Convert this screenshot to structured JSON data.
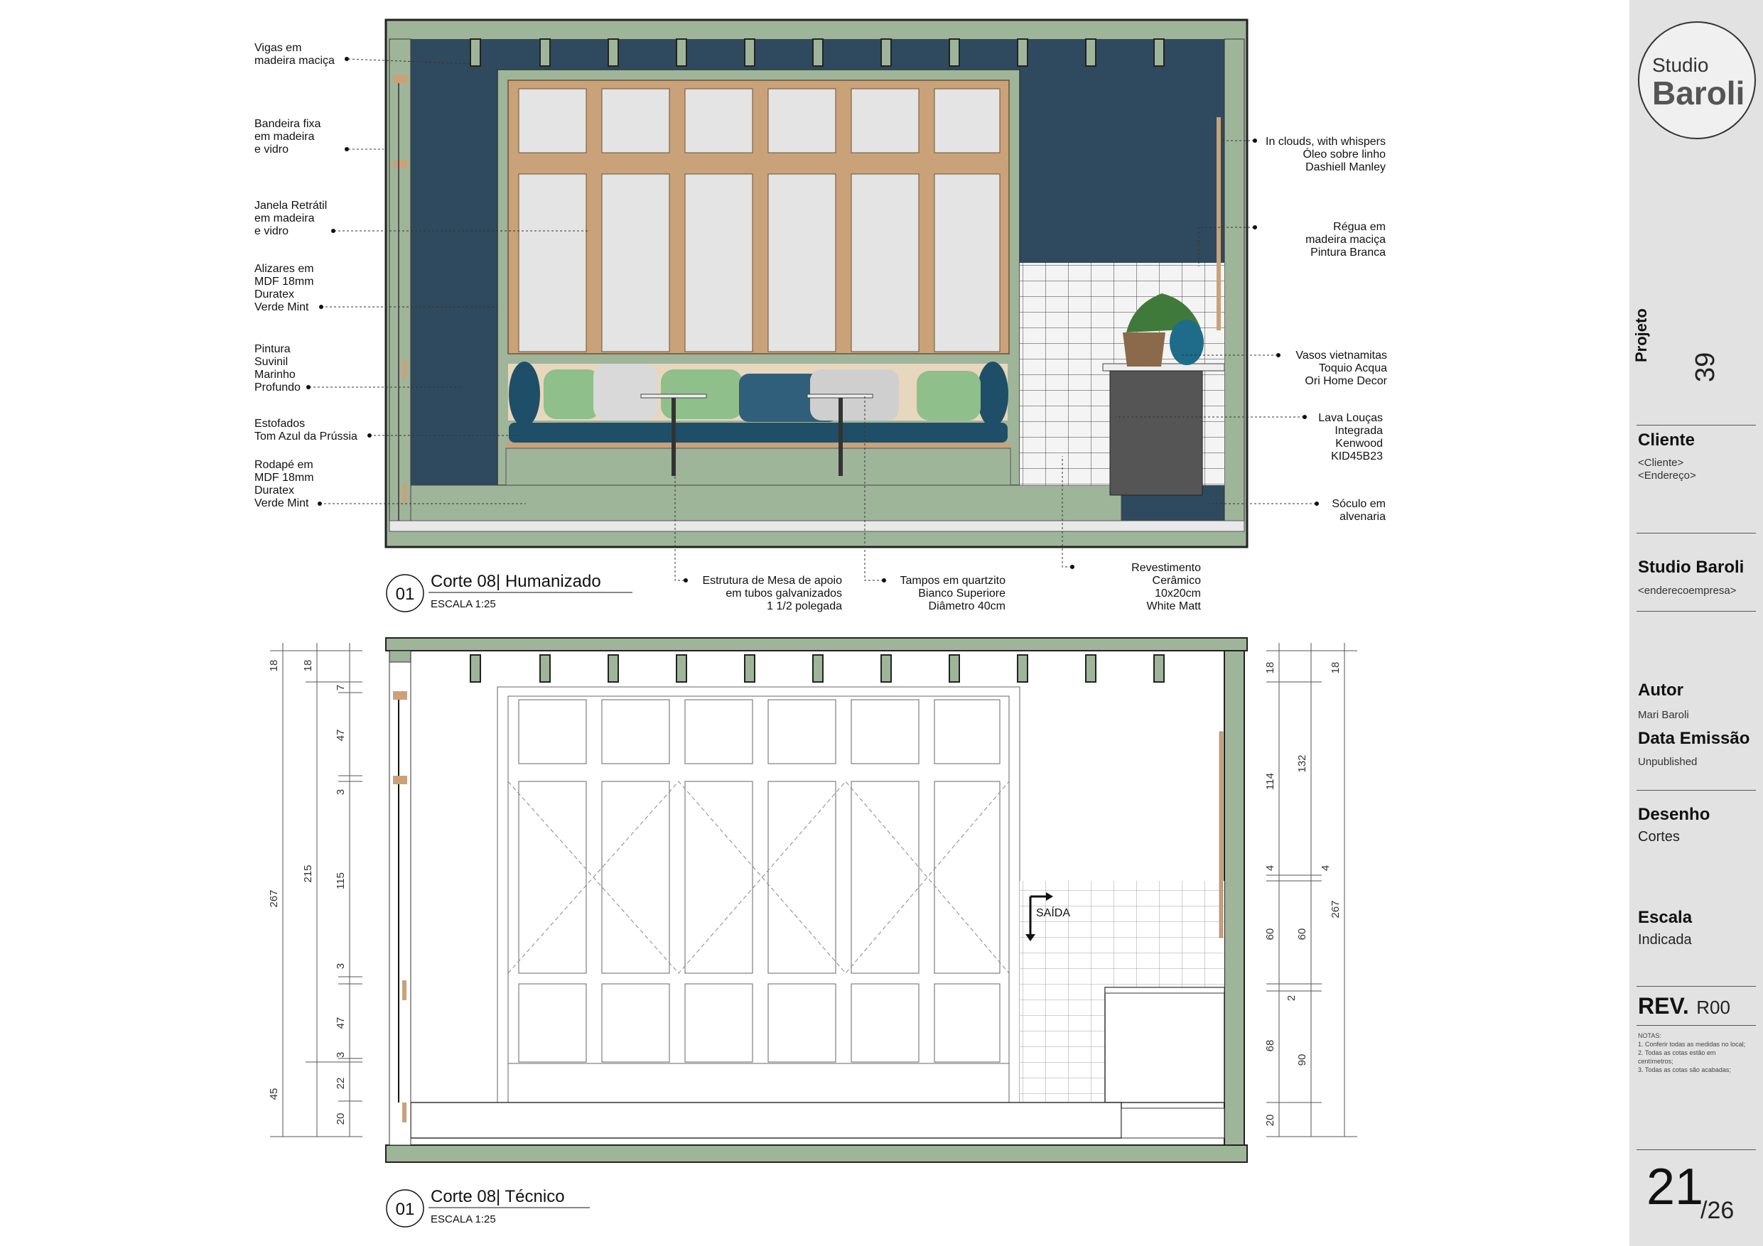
{
  "section1": {
    "number": "01",
    "title": "Corte 08| Humanizado",
    "scale": "ESCALA 1:25",
    "left_labels": [
      [
        "Vigas em",
        "madeira maciça"
      ],
      [
        "Bandeira fixa",
        "em madeira",
        "e vidro"
      ],
      [
        "Janela Retrátil",
        "em madeira",
        "e vidro"
      ],
      [
        "Alizares em",
        "MDF 18mm",
        "Duratex",
        "Verde Mint"
      ],
      [
        "Pintura",
        "Suvinil",
        "Marinho",
        "Profundo"
      ],
      [
        "Estofados",
        "Tom Azul da Prússia"
      ],
      [
        "Rodapé em",
        "MDF 18mm",
        "Duratex",
        "Verde Mint"
      ]
    ],
    "right_labels": [
      [
        "In clouds, with whispers",
        "Óleo sobre linho",
        "Dashiell Manley"
      ],
      [
        "Régua em",
        "madeira maciça",
        "Pintura Branca"
      ],
      [
        "Vasos vietnamitas",
        "Toquio Acqua",
        "Ori Home Decor"
      ],
      [
        "Lava Louças",
        "Integrada",
        "Kenwood",
        "KID45B23"
      ],
      [
        "Sóculo em",
        "alvenaria"
      ]
    ],
    "bottom_labels": [
      [
        "Estrutura de Mesa de apoio",
        "em tubos galvanizados",
        "1 1/2 polegada"
      ],
      [
        "Tampos em quartzito",
        "Bianco Superiore",
        "Diâmetro 40cm"
      ],
      [
        "Revestimento",
        "Cerâmico",
        "10x20cm",
        "White Matt"
      ]
    ]
  },
  "section2": {
    "number": "01",
    "title": "Corte 08| Técnico",
    "scale": "ESCALA 1:25",
    "exit_label": "SAÍDA",
    "dims_left_outer": "267",
    "dims_left_mid": [
      "18",
      "215",
      "45"
    ],
    "dims_left_inner": [
      "18",
      "7",
      "47",
      "3",
      "115",
      "3",
      "47",
      "3",
      "22",
      "20"
    ],
    "dims_right_inner": [
      "18",
      "114",
      "4",
      "60",
      "2",
      "68",
      "20"
    ],
    "dims_right_mid": [
      "132",
      "4",
      "60",
      "90"
    ],
    "dims_right_outer": [
      "18",
      "267"
    ]
  },
  "title_block": {
    "logo_top": "Studio",
    "logo_bottom": "Baroli",
    "project_label": "Projeto",
    "project_number": "39",
    "client_label": "Cliente",
    "client_name": "<Cliente>",
    "client_address": "<Endereço>",
    "company_label": "Studio Baroli",
    "company_address": "<enderecoempresa>",
    "author_label": "Autor",
    "author_name": "Mari Baroli",
    "date_label": "Data Emissão",
    "date_value": "Unpublished",
    "drawing_label": "Desenho",
    "drawing_value": "Cortes",
    "scale_label": "Escala",
    "scale_value": "Indicada",
    "rev_label": "REV.",
    "rev_value": "R00",
    "notes_title": "NOTAS:",
    "notes": [
      "1. Conferir todas as medidas no local;",
      "2. Todas as cotas estão em",
      "centímetros;",
      "3. Todas as cotas são acabadas;"
    ],
    "sheet_number": "21",
    "sheet_total": "/26"
  },
  "colors": {
    "wall_green": "#9fb59a",
    "navy": "#2f4a5f",
    "wood": "#c9a27a",
    "glass": "#e4e4e4",
    "cushion_teal": "#1f4f68",
    "cushion_green": "#8fbf8a",
    "tile": "#f2f2f2",
    "dark_grey": "#555555"
  }
}
